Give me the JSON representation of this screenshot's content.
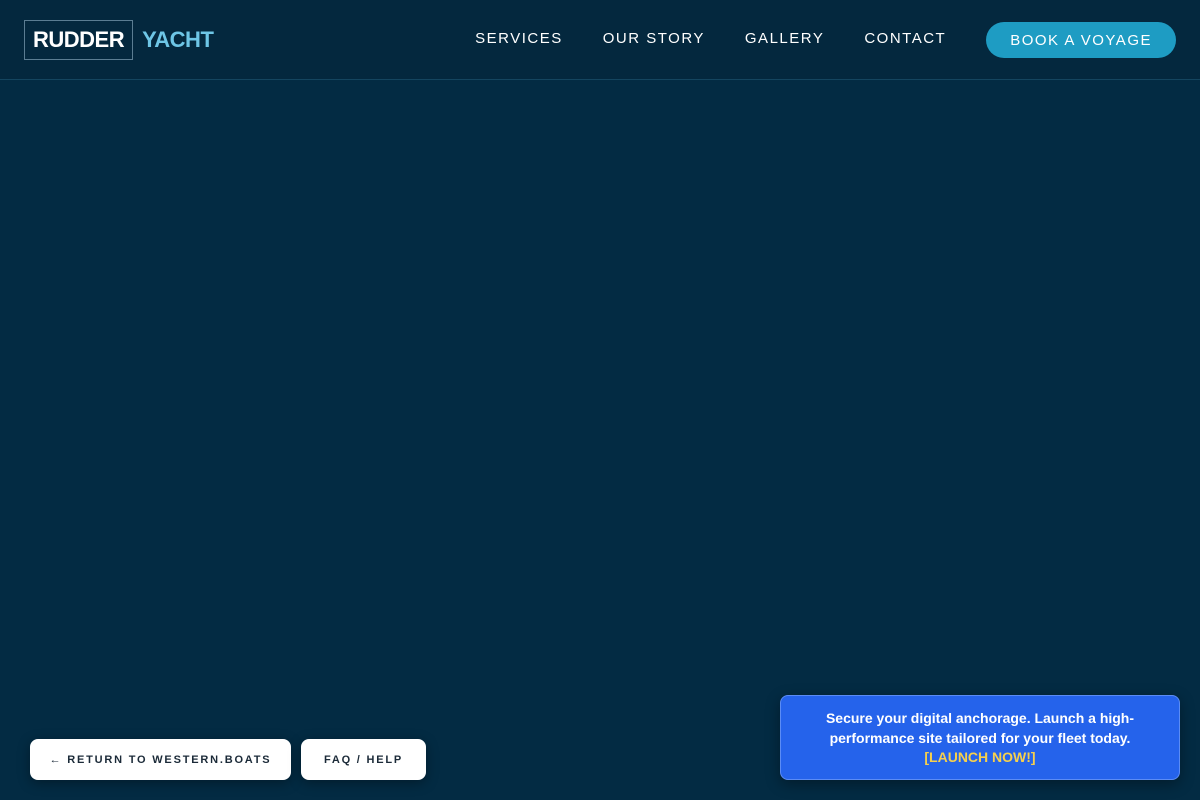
{
  "header": {
    "logo": {
      "primary": "RUDDER",
      "accent": "YACHT"
    },
    "nav": [
      {
        "label": "SERVICES"
      },
      {
        "label": "OUR STORY"
      },
      {
        "label": "GALLERY"
      },
      {
        "label": "CONTACT"
      }
    ],
    "cta_label": "BOOK A VOYAGE"
  },
  "footer_buttons": {
    "return_label": "← RETURN TO WESTERN.BOATS",
    "faq_label": "FAQ / HELP"
  },
  "promo": {
    "text": "Secure your digital anchorage. Launch a high-performance site tailored for your fleet today.",
    "link_label": "[LAUNCH NOW!]"
  },
  "colors": {
    "background": "#032b43",
    "header": "#04283e",
    "accent": "#1e9cc3",
    "logo_accent": "#6ec6e6",
    "promo": "#2563eb",
    "promo_link": "#f6d04d"
  }
}
